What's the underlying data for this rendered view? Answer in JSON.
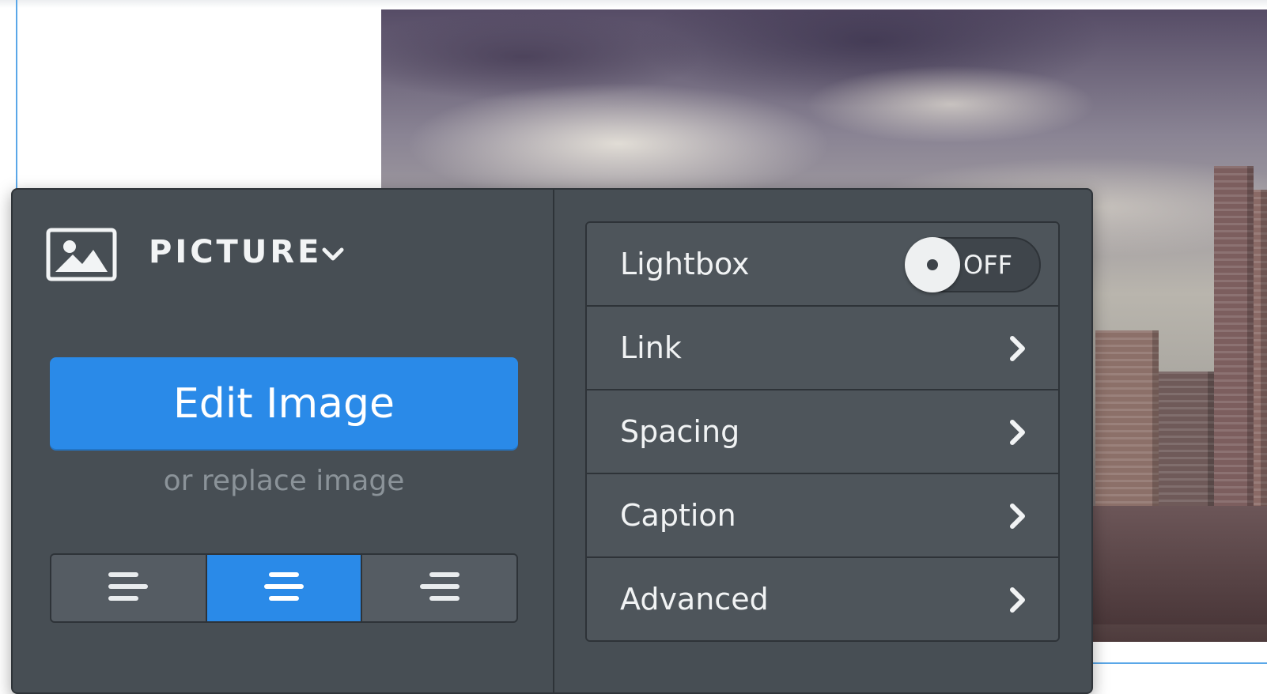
{
  "panel": {
    "title": "PICTURE",
    "edit_button_label": "Edit Image",
    "replace_link_label": "or replace image",
    "alignment": {
      "options": [
        "left",
        "center",
        "right"
      ],
      "selected": "center"
    }
  },
  "settings": {
    "lightbox": {
      "label": "Lightbox",
      "toggle_state": "OFF"
    },
    "link": {
      "label": "Link"
    },
    "spacing": {
      "label": "Spacing"
    },
    "caption": {
      "label": "Caption"
    },
    "advanced": {
      "label": "Advanced"
    }
  },
  "icons": {
    "picture": "picture-icon",
    "dropdown": "chevron-down-icon",
    "row_arrow": "chevron-right-icon",
    "align_left": "align-left-icon",
    "align_center": "align-center-icon",
    "align_right": "align-right-icon"
  },
  "colors": {
    "panel_bg": "#474e54",
    "accent": "#2a8ae8",
    "guide": "#5aa7e8"
  }
}
